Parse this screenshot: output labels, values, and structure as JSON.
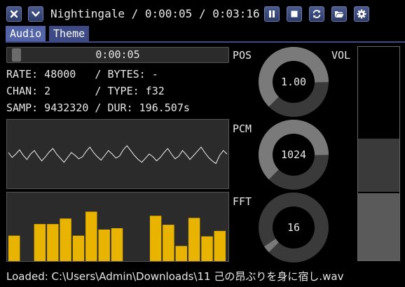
{
  "window": {
    "track_name": "Nightingale",
    "elapsed": "0:00:05",
    "duration": "0:03:16",
    "title_separator": " / "
  },
  "tabs": [
    {
      "label": "Audio",
      "active": true
    },
    {
      "label": "Theme",
      "active": false
    }
  ],
  "seek": {
    "time": "0:00:05",
    "position": 0.026
  },
  "info": {
    "rate": "RATE: 48000   / BYTES: -",
    "chan": "CHAN: 2       / TYPE: f32",
    "samp": "SAMP: 9432320 / DUR: 196.507s"
  },
  "knobs": [
    {
      "label": "POS",
      "value": "1.00",
      "level": 0.83
    },
    {
      "label": "PCM",
      "value": "1024",
      "level": 0.83
    },
    {
      "label": "FFT",
      "value": "16",
      "level": 0.04
    }
  ],
  "volume": {
    "label": "VOL",
    "level": 0.57
  },
  "fft_bars": [
    0.37,
    0.0,
    0.54,
    0.54,
    0.62,
    0.37,
    0.72,
    0.46,
    0.48,
    0.0,
    0.0,
    0.66,
    0.53,
    0.22,
    0.63,
    0.36,
    0.44
  ],
  "waveform": [
    0.52,
    0.45,
    0.5,
    0.56,
    0.48,
    0.42,
    0.5,
    0.55,
    0.47,
    0.4,
    0.46,
    0.53,
    0.58,
    0.5,
    0.44,
    0.38,
    0.45,
    0.52,
    0.48,
    0.43,
    0.46,
    0.54,
    0.6,
    0.52,
    0.46,
    0.41,
    0.48,
    0.55,
    0.5,
    0.44,
    0.47,
    0.56,
    0.62,
    0.55,
    0.48,
    0.42,
    0.38,
    0.44,
    0.5,
    0.46,
    0.4,
    0.45,
    0.52,
    0.58,
    0.5,
    0.43,
    0.47,
    0.55,
    0.49,
    0.42,
    0.48,
    0.54,
    0.6,
    0.52,
    0.45,
    0.4,
    0.36,
    0.48,
    0.55,
    0.5
  ],
  "colors": {
    "accent_bar": "#e8b400",
    "knob_fill": "#7a7a7a",
    "knob_track": "#3a3a3a",
    "panel": "#2b2b2b",
    "button": "#3d4a86"
  },
  "icons": [
    "close-icon",
    "chevron-down-icon",
    "pause-icon",
    "stop-icon",
    "repeat-icon",
    "folder-open-icon",
    "gear-icon"
  ],
  "status": {
    "text": "Loaded: C:\\Users\\Admin\\Downloads\\11 己の昂ぶりを身に宿し.wav"
  }
}
